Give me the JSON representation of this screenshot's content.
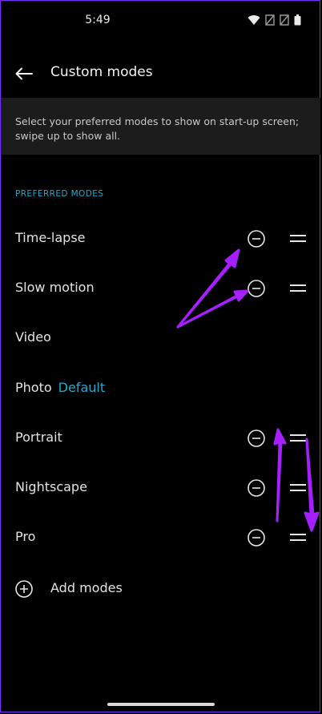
{
  "status_bar": {
    "time": "5:49",
    "icons": [
      "wifi-icon",
      "no-sim-icon",
      "no-sim-icon",
      "battery-icon"
    ]
  },
  "app_bar": {
    "back_icon": "arrow-left-icon",
    "title": "Custom modes"
  },
  "info": {
    "text": "Select your preferred modes to show on start-up screen; swipe up to show all."
  },
  "section": {
    "header": "PREFERRED MODES"
  },
  "modes": [
    {
      "label": "Time-lapse",
      "removable": true
    },
    {
      "label": "Slow motion",
      "removable": true
    },
    {
      "label": "Video",
      "removable": false
    },
    {
      "label": "Photo",
      "badge": "Default",
      "removable": false
    },
    {
      "label": "Portrait",
      "removable": true
    },
    {
      "label": "Nightscape",
      "removable": true
    },
    {
      "label": "Pro",
      "removable": true
    }
  ],
  "add": {
    "label": "Add modes",
    "icon": "plus-circle-icon"
  },
  "colors": {
    "background": "#000000",
    "accent": "#2aa6c9",
    "banner": "#1c1c1c",
    "annotation": "#a51fff"
  }
}
